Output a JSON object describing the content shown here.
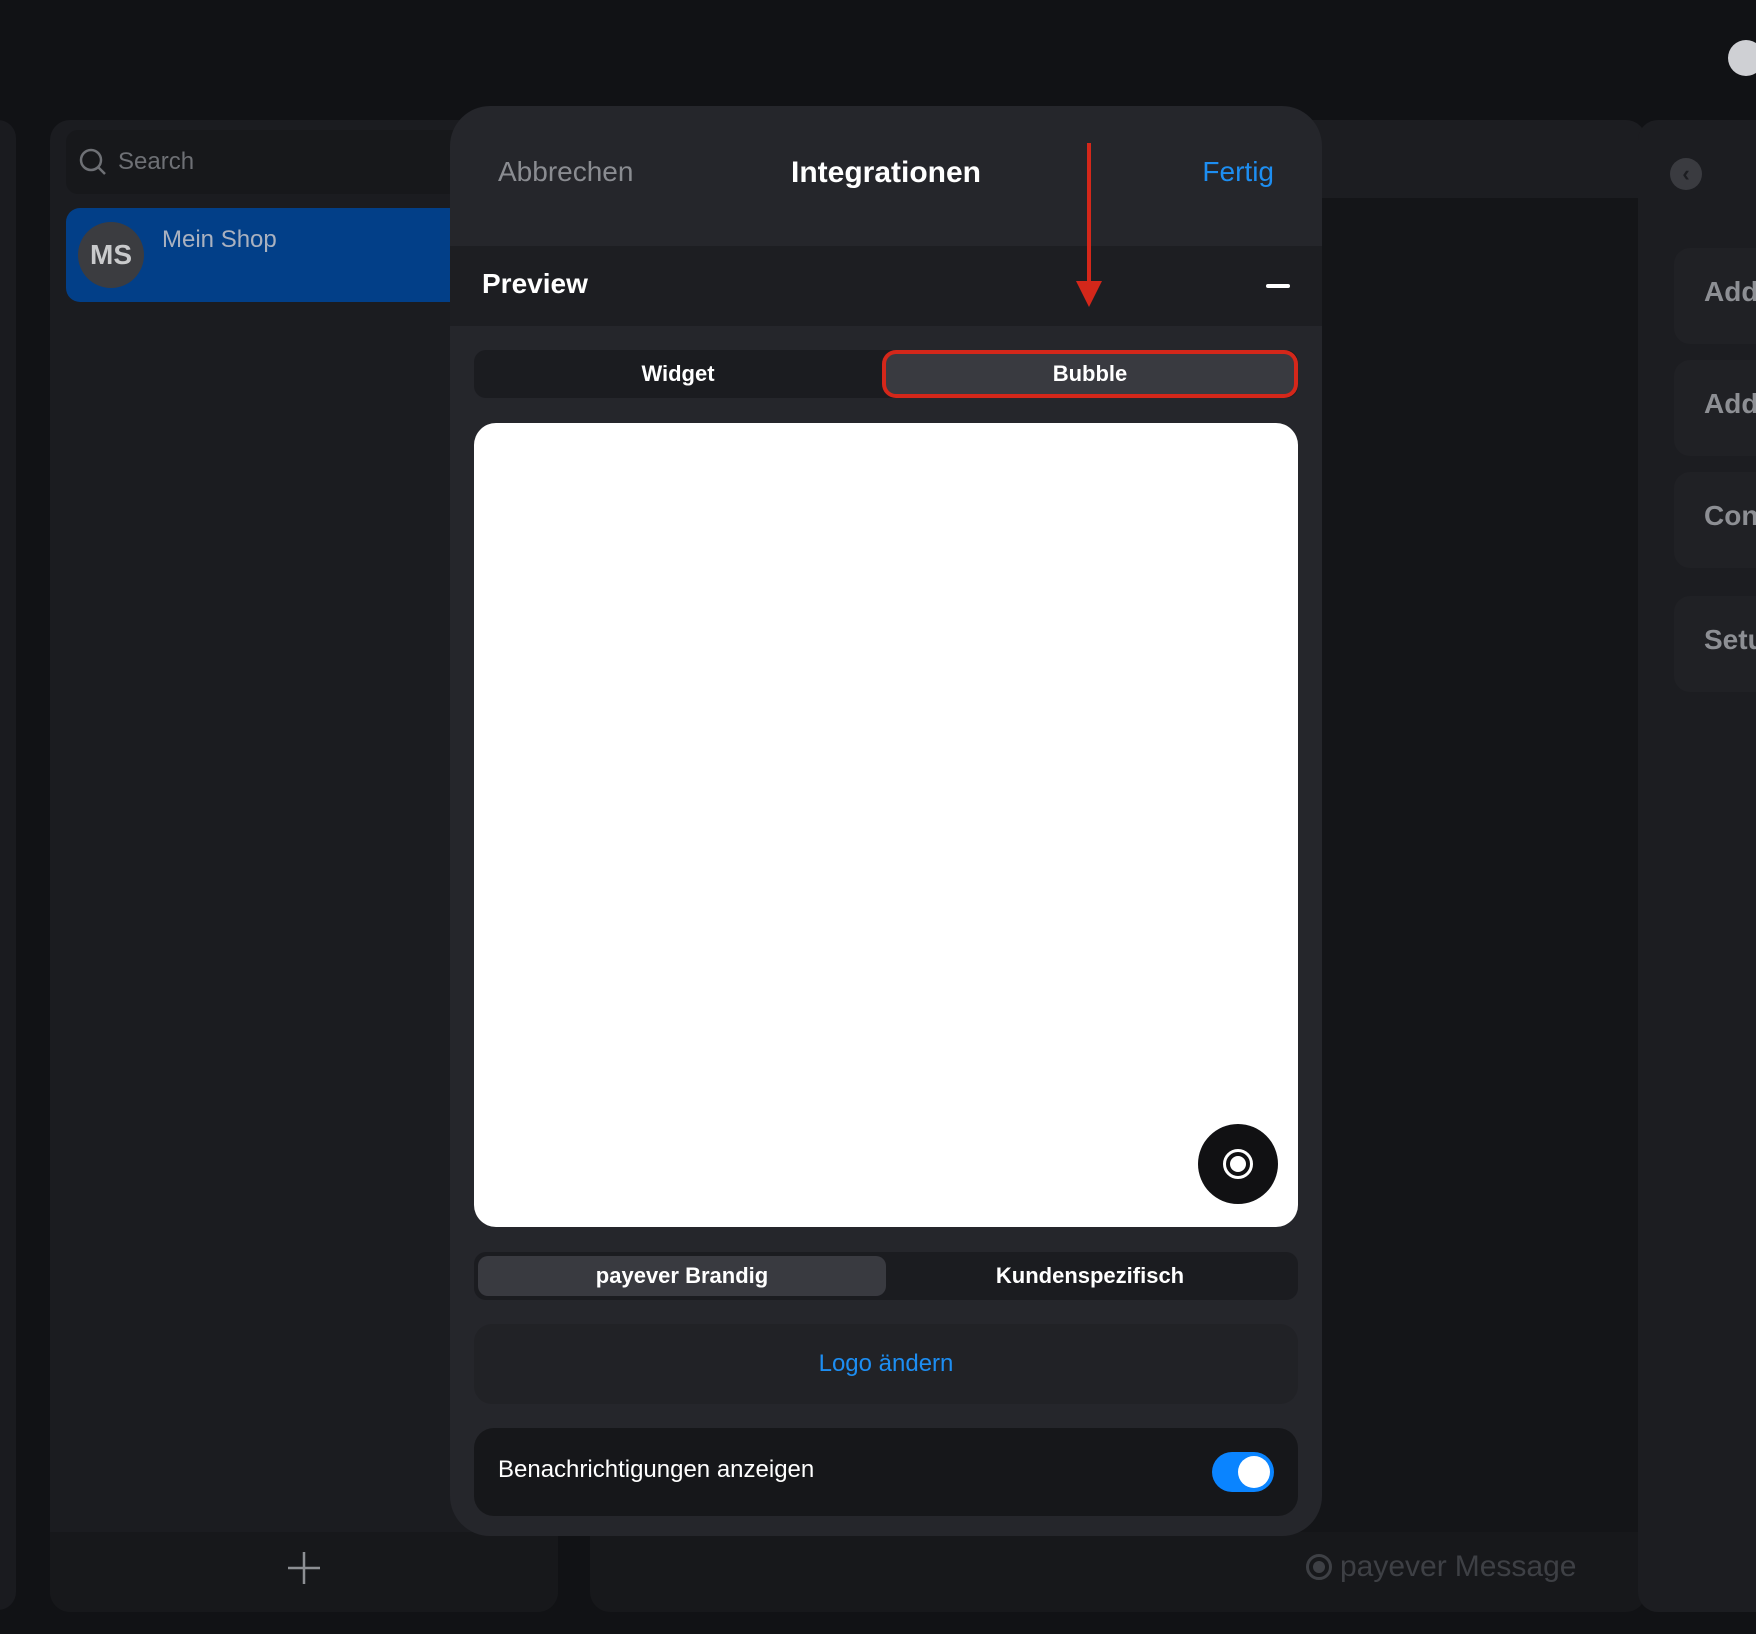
{
  "search": {
    "placeholder": "Search"
  },
  "shop": {
    "initials": "MS",
    "name": "Mein Shop"
  },
  "brand": {
    "name": "payever",
    "product": "Message"
  },
  "right_panel": {
    "cards": [
      "Add",
      "Add",
      "Con",
      "Setu"
    ]
  },
  "modal": {
    "cancel_label": "Abbrechen",
    "title": "Integrationen",
    "done_label": "Fertig",
    "section_title": "Preview",
    "view_tabs": [
      "Widget",
      "Bubble"
    ],
    "selected_view": "Bubble",
    "branding_tabs": [
      "payever Brandig",
      "Kundenspezifisch"
    ],
    "selected_branding": "payever Brandig",
    "logo_button_label": "Logo ändern",
    "notifications_label": "Benachrichtigungen anzeigen",
    "notifications_enabled": true
  },
  "colors": {
    "accent": "#1d8ef2",
    "toggle_on": "#0a84ff",
    "selected_item": "#023f88",
    "annotation": "#d4271a"
  },
  "icons": [
    "user-icon",
    "search-icon",
    "plus-icon",
    "back-icon",
    "collapse-icon",
    "bubble-chat-icon",
    "payever-logo-icon"
  ]
}
